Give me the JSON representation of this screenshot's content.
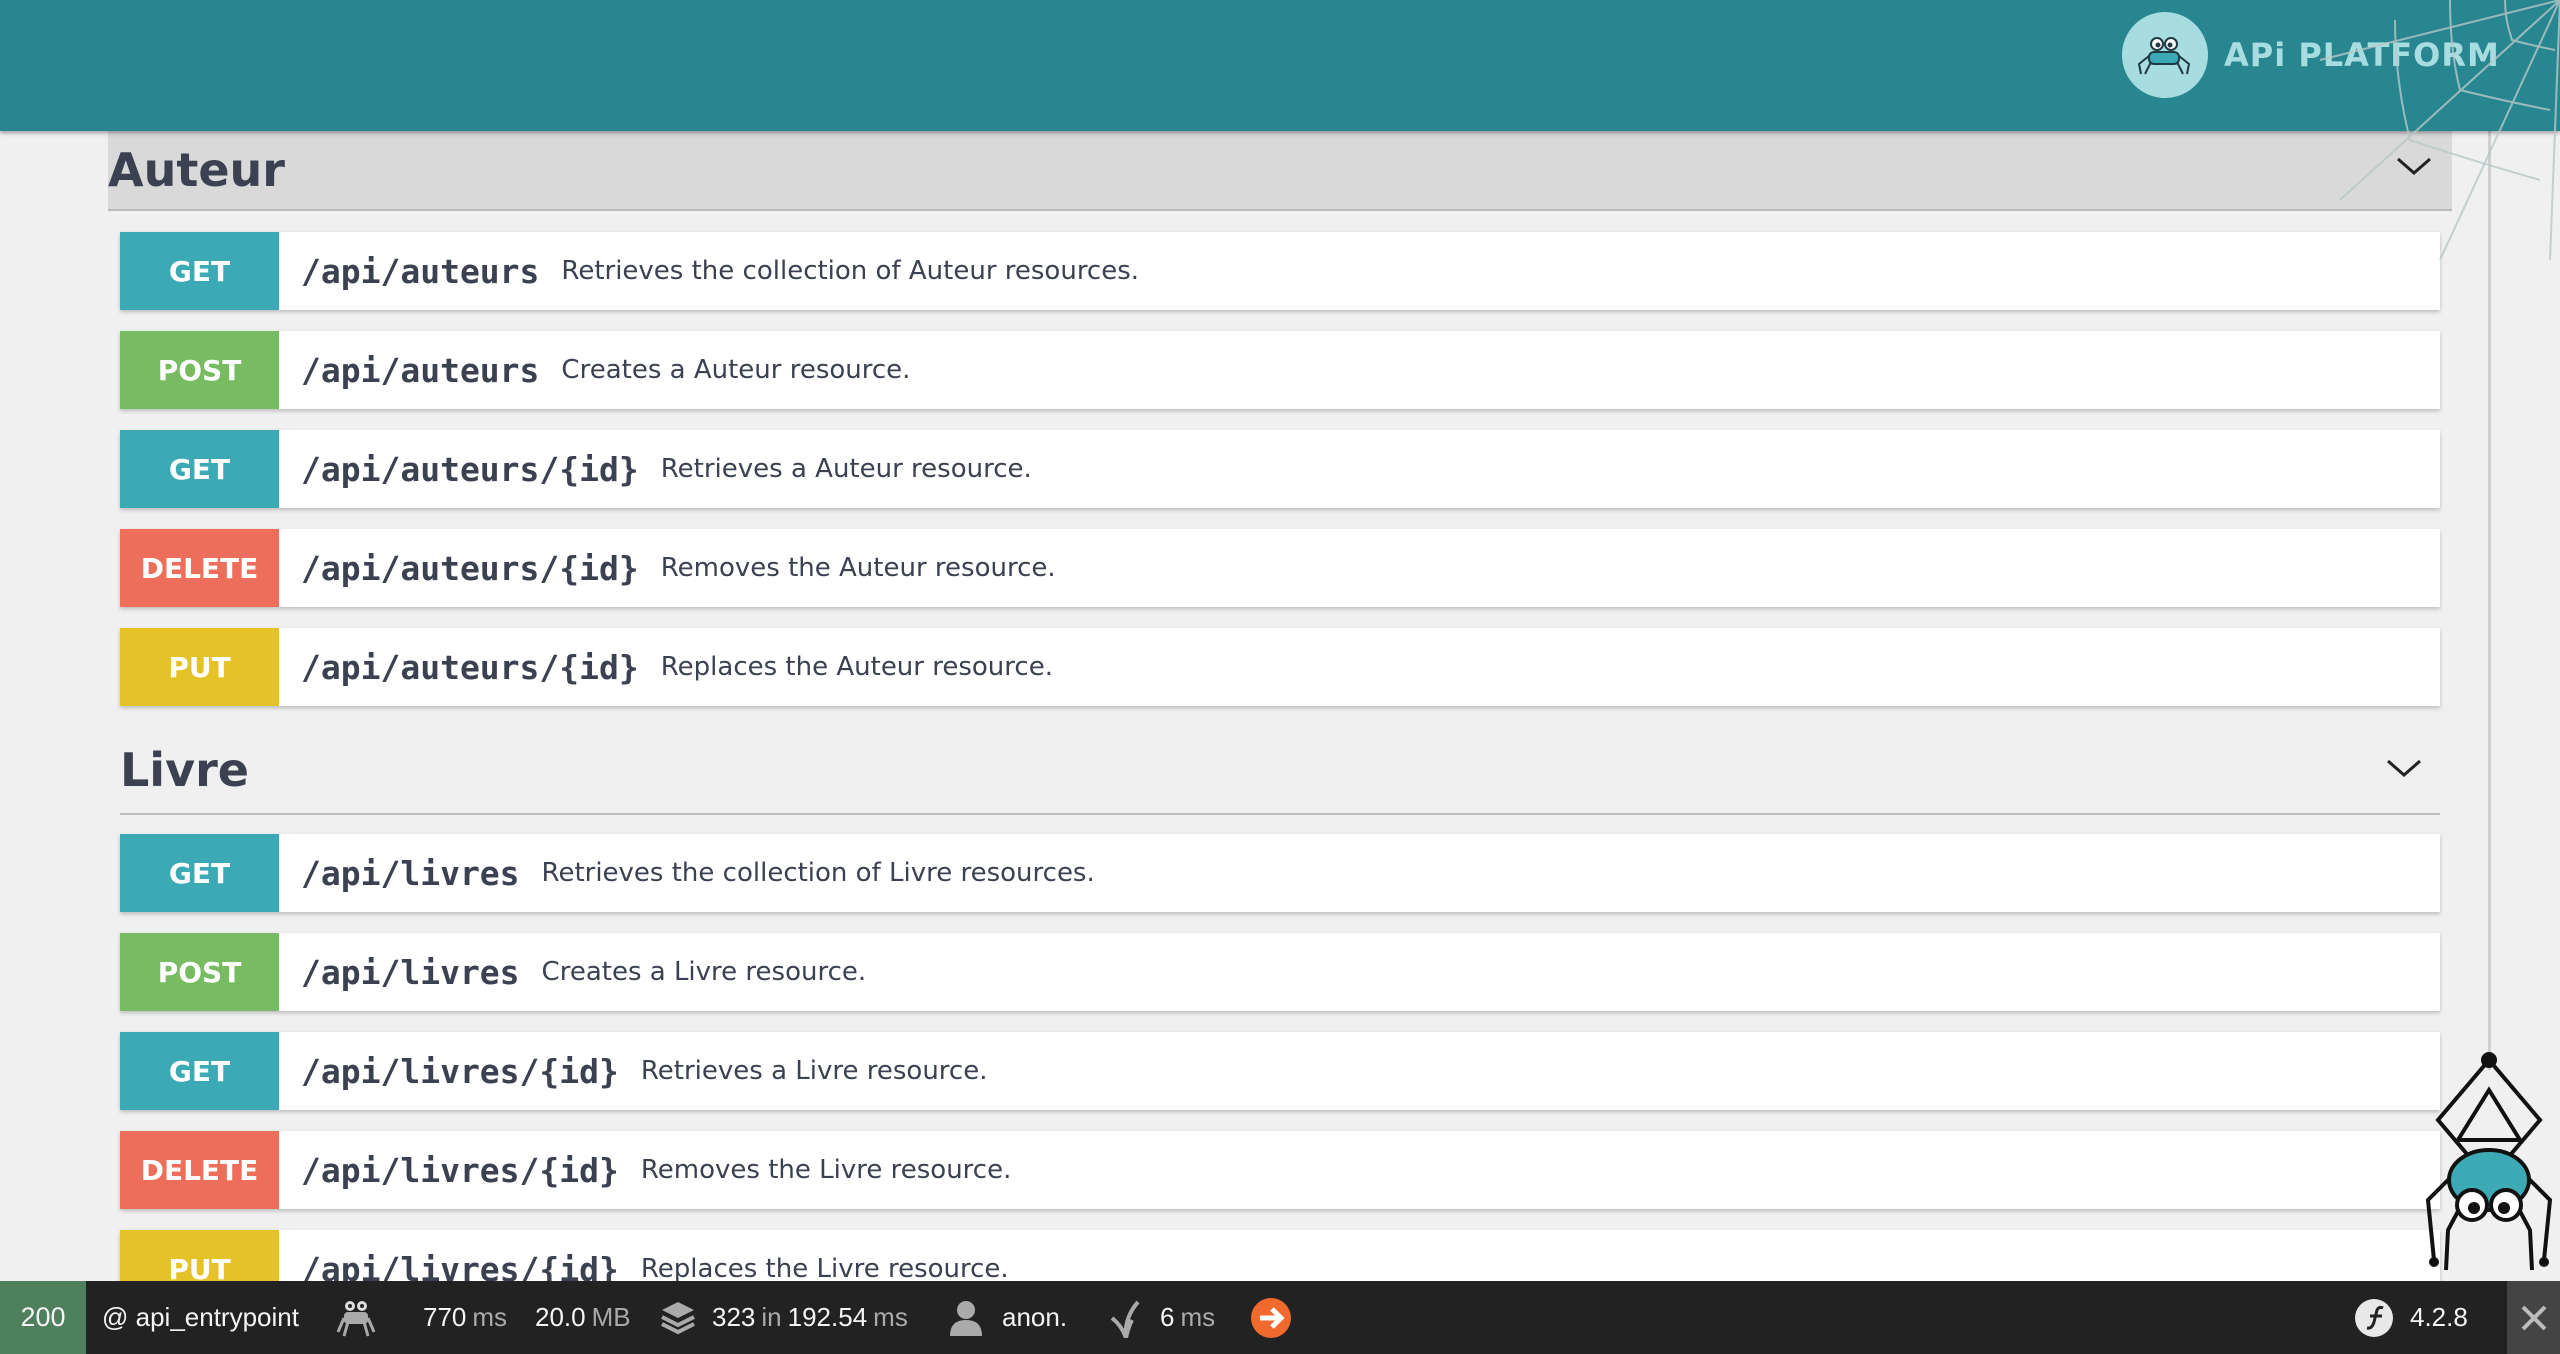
{
  "header": {
    "logo_text": "APi PLATFORM",
    "logo_icon": "spider-logo-icon"
  },
  "groups": [
    {
      "title": "Auteur",
      "operations": [
        {
          "method": "GET",
          "path": "/api/auteurs",
          "summary": "Retrieves the collection of Auteur resources."
        },
        {
          "method": "POST",
          "path": "/api/auteurs",
          "summary": "Creates a Auteur resource."
        },
        {
          "method": "GET",
          "path": "/api/auteurs/{id}",
          "summary": "Retrieves a Auteur resource."
        },
        {
          "method": "DELETE",
          "path": "/api/auteurs/{id}",
          "summary": "Removes the Auteur resource."
        },
        {
          "method": "PUT",
          "path": "/api/auteurs/{id}",
          "summary": "Replaces the Auteur resource."
        }
      ]
    },
    {
      "title": "Livre",
      "operations": [
        {
          "method": "GET",
          "path": "/api/livres",
          "summary": "Retrieves the collection of Livre resources."
        },
        {
          "method": "POST",
          "path": "/api/livres",
          "summary": "Creates a Livre resource."
        },
        {
          "method": "GET",
          "path": "/api/livres/{id}",
          "summary": "Retrieves a Livre resource."
        },
        {
          "method": "DELETE",
          "path": "/api/livres/{id}",
          "summary": "Removes the Livre resource."
        },
        {
          "method": "PUT",
          "path": "/api/livres/{id}",
          "summary": "Replaces the Livre resource."
        }
      ]
    }
  ],
  "toolbar": {
    "status": "200",
    "route": "@ api_entrypoint",
    "time_value": "770",
    "time_unit": "ms",
    "memory_value": "20.0",
    "memory_unit": "MB",
    "db_count": "323",
    "db_in": "in",
    "db_time": "192.54",
    "db_unit": "ms",
    "user": "anon.",
    "twig_value": "6",
    "twig_unit": "ms",
    "version": "4.2.8"
  },
  "colors": {
    "header": "#288690",
    "get": "#3caab5",
    "post": "#78bc61",
    "delete": "#ed6f5b",
    "put": "#e6c229",
    "status_ok": "#4f805d"
  }
}
